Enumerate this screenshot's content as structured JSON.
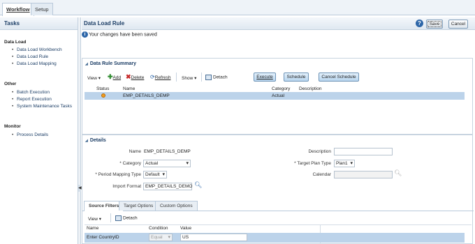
{
  "top_tabs": [
    {
      "label": "Workflow",
      "active": true
    },
    {
      "label": "Setup",
      "active": false
    }
  ],
  "tasks": {
    "title": "Tasks",
    "groups": [
      {
        "label": "Data Load",
        "items": [
          "Data Load Workbench",
          "Data Load Rule",
          "Data Load Mapping"
        ]
      },
      {
        "label": "Other",
        "items": [
          "Batch Execution",
          "Report Execution",
          "System Maintenance Tasks"
        ]
      },
      {
        "label": "Monitor",
        "items": [
          "Process Details"
        ]
      }
    ]
  },
  "main": {
    "title": "Data Load Rule",
    "help_icon": "?",
    "save_label": "Save",
    "cancel_label": "Cancel",
    "message": "Your changes have been saved"
  },
  "summary": {
    "title": "Data Rule Summary",
    "toolbar": {
      "view": "View ▾",
      "add": "Add",
      "delete": "Delete",
      "refresh": "Refresh",
      "show": "Show ▾",
      "detach": "Detach",
      "execute": "Execute",
      "schedule": "Schedule",
      "cancel_schedule": "Cancel Schedule"
    },
    "columns": [
      "Status",
      "Name",
      "Category",
      "Description"
    ],
    "rows": [
      {
        "status": "pending",
        "name": "EMP_DETAILS_DEMP",
        "category": "Actual",
        "description": ""
      }
    ]
  },
  "details": {
    "title": "Details",
    "name_label": "Name",
    "name_value": "EMP_DETAILS_DEMP",
    "category_label": "* Category",
    "category_value": "Actual",
    "period_label": "* Period Mapping Type",
    "period_value": "Default",
    "import_label": "Import Format",
    "import_value": "EMP_DETAILS_DEMO",
    "description_label": "Description",
    "description_value": "",
    "target_plan_label": "* Target Plan Type",
    "target_plan_value": "Plan1",
    "calendar_label": "Calendar",
    "calendar_value": ""
  },
  "sub_tabs": [
    {
      "label": "Source Filters",
      "active": true
    },
    {
      "label": "Target Options",
      "active": false
    },
    {
      "label": "Custom Options",
      "active": false
    }
  ],
  "filters": {
    "toolbar": {
      "view": "View ▾",
      "detach": "Detach"
    },
    "columns": [
      "Name",
      "Condition",
      "Value"
    ],
    "rows": [
      {
        "name": "Enter CountryID",
        "condition": "Equal",
        "value": "US"
      }
    ]
  },
  "colors": {
    "accent": "#1c3e66",
    "selected_row": "#bcd3ea",
    "header_bg": "#dfe8f1"
  }
}
